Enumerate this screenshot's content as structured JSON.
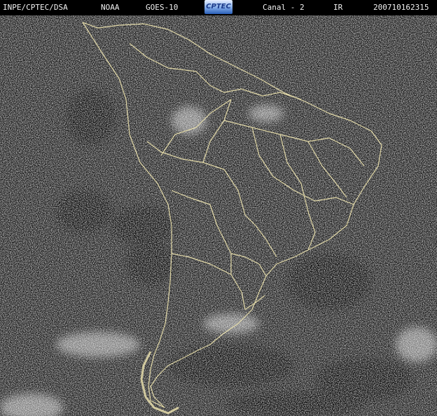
{
  "header": {
    "institution": "INPE/CPTEC/DSA",
    "agency": "NOAA",
    "satellite": "GOES-10",
    "logo_text": "CPTEC",
    "channel": "Canal - 2",
    "band": "IR",
    "timestamp": "200710162315"
  },
  "colors": {
    "background": "#000000",
    "header_text": "#f2f2f2",
    "borders": "#f0e6b0",
    "noise_light": "#d8d8d8",
    "noise_dark": "#2a2a2a"
  }
}
